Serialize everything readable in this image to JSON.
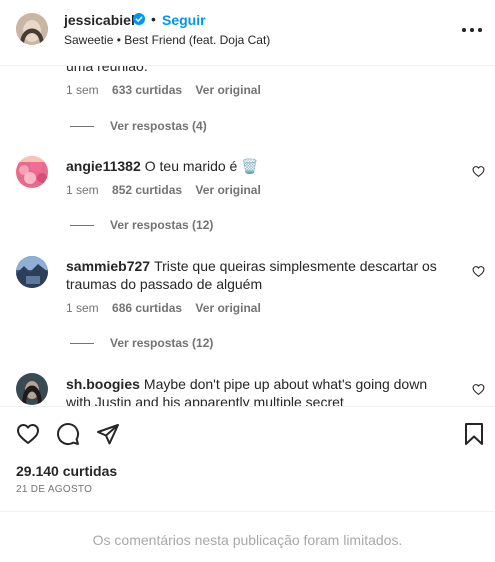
{
  "header": {
    "username": "jessicabiel",
    "separator": "•",
    "follow_label": "Seguir",
    "song": "Saweetie • Best Friend (feat. Doja Cat)"
  },
  "comments": {
    "partial_text": "uma reunião.",
    "first_meta": {
      "time": "1 sem",
      "likes": "633 curtidas",
      "original": "Ver original",
      "replies": "Ver respostas (4)"
    },
    "items": [
      {
        "user": "angie11382",
        "text": "O teu marido é 🗑️",
        "time": "1 sem",
        "likes": "852 curtidas",
        "original": "Ver original",
        "replies": "Ver respostas (12)"
      },
      {
        "user": "sammieb727",
        "text": "Triste que queiras simplesmente descartar os traumas do passado de alguém",
        "time": "1 sem",
        "likes": "686 curtidas",
        "original": "Ver original",
        "replies": "Ver respostas (12)"
      },
      {
        "user": "sh.boogies",
        "text": "Maybe don't pipe up about what's going down with Justin and his apparently multiple secret"
      }
    ]
  },
  "post": {
    "likes": "29.140 curtidas",
    "date": "21 DE AGOSTO"
  },
  "footer": {
    "limited_text": "Os comentários nesta publicação foram limitados."
  },
  "icons": {
    "verified": "verified-badge-icon",
    "like": "heart-icon",
    "comment": "comment-icon",
    "share": "send-icon",
    "save": "bookmark-icon",
    "more": "more-options-icon"
  },
  "colors": {
    "accent": "#0095f6",
    "secondary_text": "#737373",
    "muted_text": "#a8a8a8"
  }
}
